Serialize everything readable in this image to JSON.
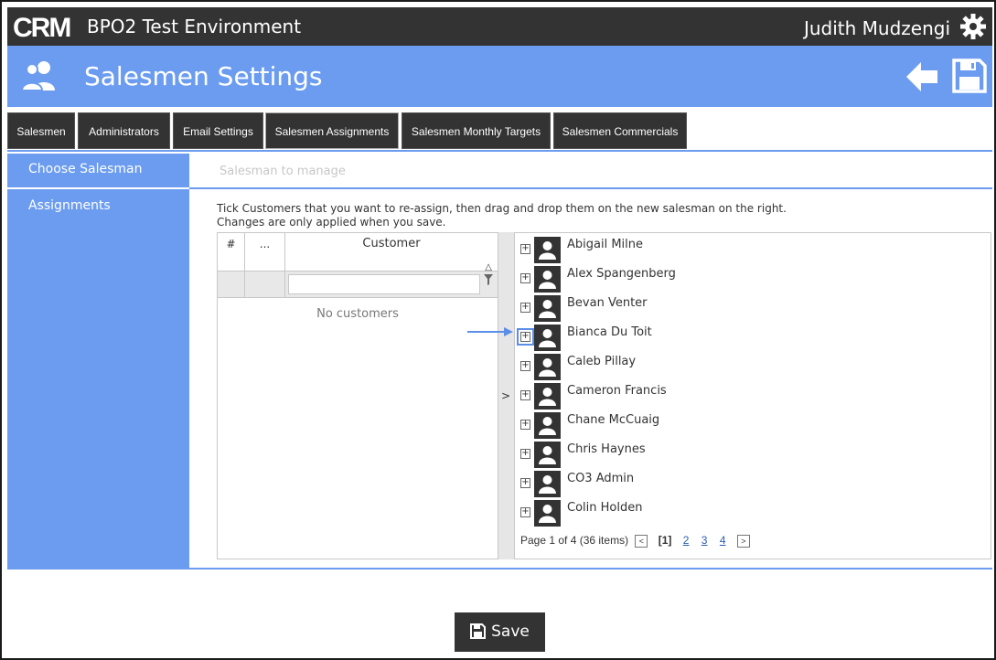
{
  "app": {
    "logo_text": "CRM",
    "title": "BPO2 Test Environment",
    "user": "Judith Mudzengi"
  },
  "header": {
    "title": "Salesmen Settings"
  },
  "tabs": [
    {
      "label": "Salesmen"
    },
    {
      "label": "Administrators"
    },
    {
      "label": "Email Settings"
    },
    {
      "label": "Salesmen Assignments",
      "active": true
    },
    {
      "label": "Salesmen Monthly Targets"
    },
    {
      "label": "Salesmen Commercials"
    }
  ],
  "sidebar": {
    "choose_salesman": "Choose Salesman",
    "assignments": "Assignments"
  },
  "main": {
    "salesman_placeholder": "Salesman to manage",
    "instructions_line1": "Tick Customers that you want to re-assign, then drag and drop them on the new salesman on the right.",
    "instructions_line2": "Changes are only applied when you save."
  },
  "customer_grid": {
    "col_hash": "#",
    "col_dots": "...",
    "col_customer": "Customer",
    "sort_glyph": "△",
    "empty_text": "No customers"
  },
  "splitter": {
    "arrow": ">"
  },
  "salesmen": [
    "Abigail Milne",
    "Alex Spangenberg",
    "Bevan Venter",
    "Bianca Du Toit",
    "Caleb Pillay",
    "Cameron Francis",
    "Chane McCuaig",
    "Chris Haynes",
    "CO3 Admin",
    "Colin Holden"
  ],
  "pager": {
    "summary": "Page 1 of 4 (36 items)",
    "prev": "<",
    "current": "[1]",
    "pages": [
      "2",
      "3",
      "4"
    ],
    "next": ">"
  },
  "footer": {
    "save_label": "Save"
  },
  "colors": {
    "dark": "#333333",
    "accent": "#6b9cf0"
  }
}
